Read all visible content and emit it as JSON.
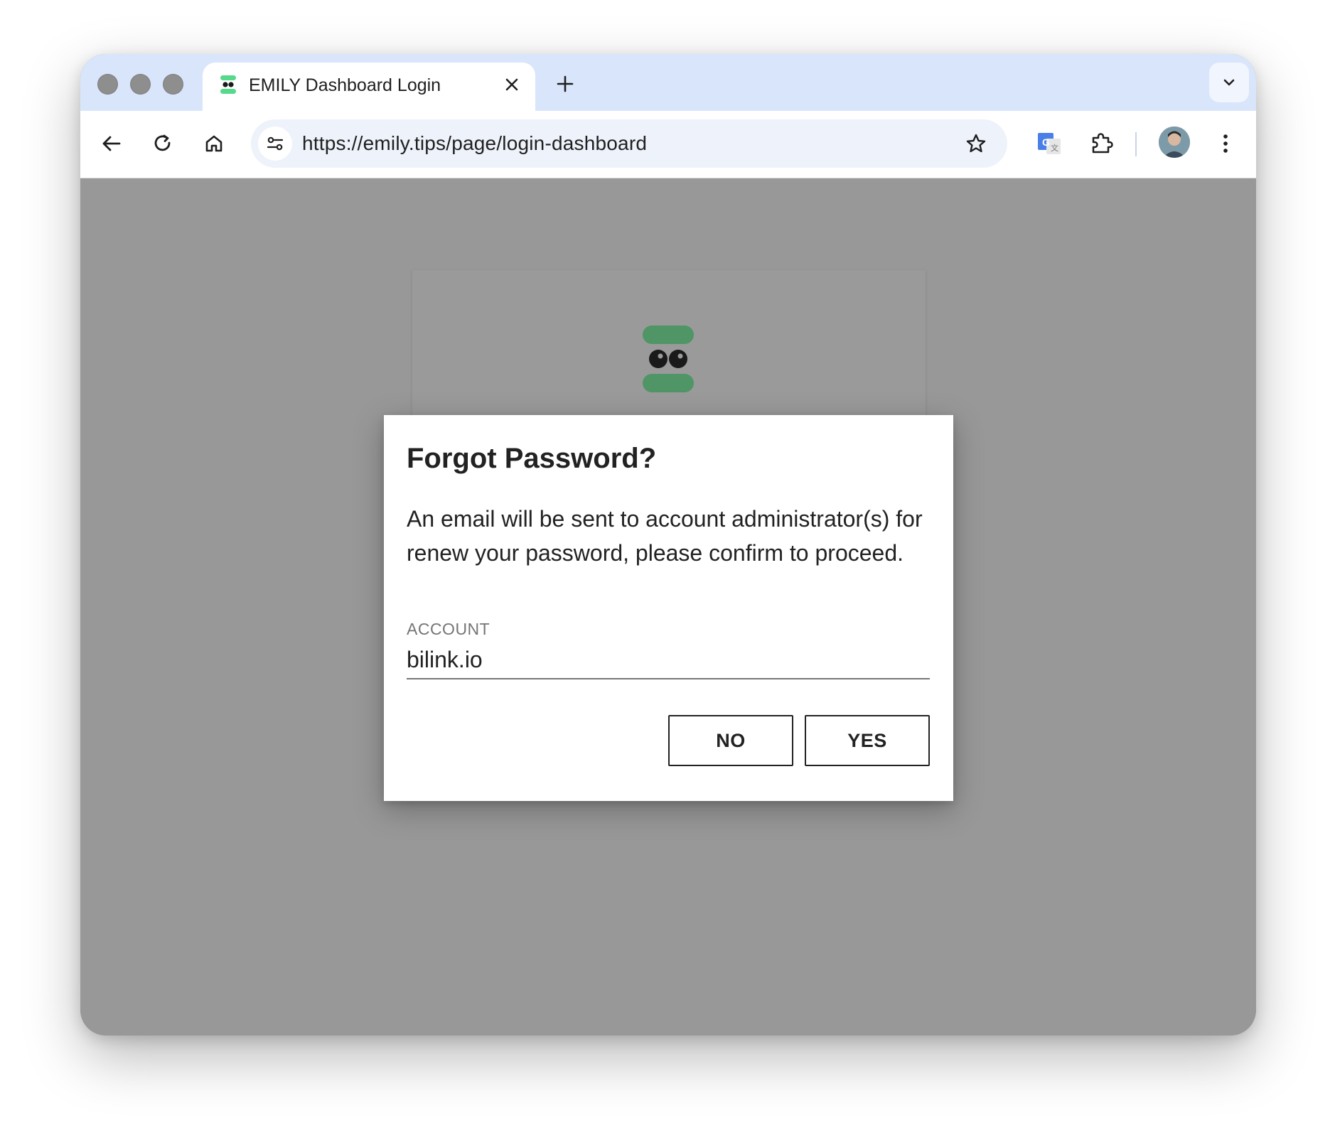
{
  "browser": {
    "tab": {
      "title": "EMILY Dashboard Login",
      "favicon": "emily-logo-icon"
    },
    "url": "https://emily.tips/page/login-dashboard",
    "icons": {
      "back": "arrow-left-icon",
      "reload": "reload-icon",
      "home": "home-icon",
      "site_info": "tune-icon",
      "bookmark": "star-icon",
      "translate": "google-translate-icon",
      "extensions": "puzzle-icon",
      "menu": "kebab-menu-icon",
      "new_tab": "plus-icon",
      "tab_search": "chevron-down-icon"
    }
  },
  "app": {
    "brand_colors": {
      "logo_green": "#4f9566",
      "logo_eyes": "#1a1a1a"
    }
  },
  "dialog": {
    "title": "Forgot Password?",
    "message": "An email will be sent to account administrator(s) for renew your password, please confirm to proceed.",
    "account_label": "ACCOUNT",
    "account_value": "bilink.io",
    "no_label": "NO",
    "yes_label": "YES"
  }
}
